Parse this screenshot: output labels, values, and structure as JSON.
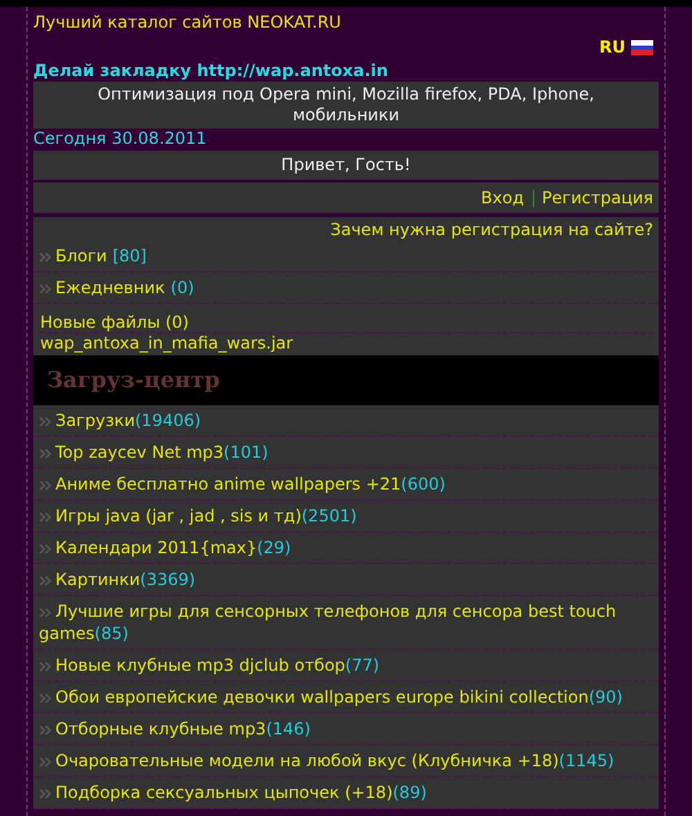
{
  "header": {
    "title": "Лучший каталог сайтов NEOKAT.RU",
    "language": "RU"
  },
  "bookmark": "Делай закладку http://wap.antoxa.in",
  "optimization": "Оптимизация под Opera mini, Mozilla firefox, PDA, Iphone, мобильники",
  "date": "Сегодня 30.08.2011",
  "greeting": "Привет, Гость!",
  "auth_links": [
    "Вход",
    "Регистрация"
  ],
  "why_register": "Зачем нужна регистрация на сайте?",
  "community": [
    {
      "name": "Блоги",
      "count": "[80]"
    },
    {
      "name": "Ежедневник",
      "count": "(0)"
    }
  ],
  "new_files": {
    "label": "Новые файлы (0)",
    "file": "wap_antoxa_in_mafia_wars.jar"
  },
  "download_center": {
    "title": "Загруз-центр",
    "items": [
      {
        "name": "Загрузки",
        "count": "(19406)"
      },
      {
        "name": "Top zaycev Net mp3",
        "count": "(101)"
      },
      {
        "name": "Аниме бесплатно anime wallpapers +21",
        "count": "(600)"
      },
      {
        "name": "Игры java (jar , jad , sis и тд)",
        "count": "(2501)"
      },
      {
        "name": "Календари 2011{max}",
        "count": "(29)"
      },
      {
        "name": "Картинки",
        "count": "(3369)"
      },
      {
        "name": "Лучшие игры для сенсорных телефонов для сенсора best touch games",
        "count": "(85)"
      },
      {
        "name": "Новые клубные mp3 djclub отбор",
        "count": "(77)"
      },
      {
        "name": "Обои европейские девочки wallpapers europe bikini collection",
        "count": "(90)"
      },
      {
        "name": "Отборные клубные mp3",
        "count": "(146)"
      },
      {
        "name": "Очаровательные модели на любой вкус (Клубничка +18)",
        "count": "(1145)"
      },
      {
        "name": "Подборка сексуальных цыпочек (+18)",
        "count": "(89)"
      }
    ]
  }
}
